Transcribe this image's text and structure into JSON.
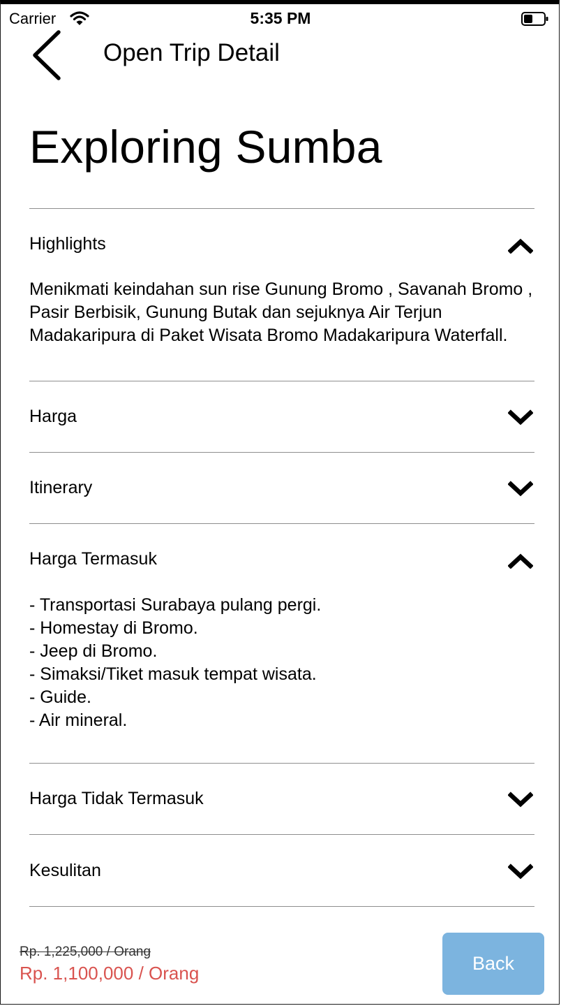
{
  "status_bar": {
    "carrier": "Carrier",
    "time": "5:35 PM"
  },
  "nav": {
    "title": "Open Trip Detail"
  },
  "trip": {
    "title": "Exploring Sumba"
  },
  "sections": [
    {
      "label": "Highlights",
      "expanded": true,
      "content": "Menikmati keindahan sun rise Gunung Bromo , Savanah Bromo , Pasir Berbisik, Gunung Butak dan sejuknya Air Terjun Madakaripura di Paket Wisata Bromo Madakaripura Waterfall."
    },
    {
      "label": "Harga",
      "expanded": false
    },
    {
      "label": "Itinerary",
      "expanded": false
    },
    {
      "label": "Harga Termasuk",
      "expanded": true,
      "content": "- Transportasi Surabaya pulang pergi.\n- Homestay di Bromo.\n- Jeep di Bromo.\n- Simaksi/Tiket masuk tempat wisata.\n- Guide.\n- Air mineral."
    },
    {
      "label": "Harga Tidak Termasuk",
      "expanded": false
    },
    {
      "label": "Kesulitan",
      "expanded": false
    }
  ],
  "footer": {
    "old_price": "Rp. 1,225,000 / Orang",
    "new_price": "Rp. 1,100,000 / Orang",
    "back_label": "Back"
  },
  "colors": {
    "price_accent": "#d9534f",
    "button_bg": "#7cb4df",
    "divider": "#8e8e8e"
  },
  "icons": {
    "back": "chevron-left-icon",
    "expanded": "chevron-up-icon",
    "collapsed": "chevron-down-icon"
  }
}
